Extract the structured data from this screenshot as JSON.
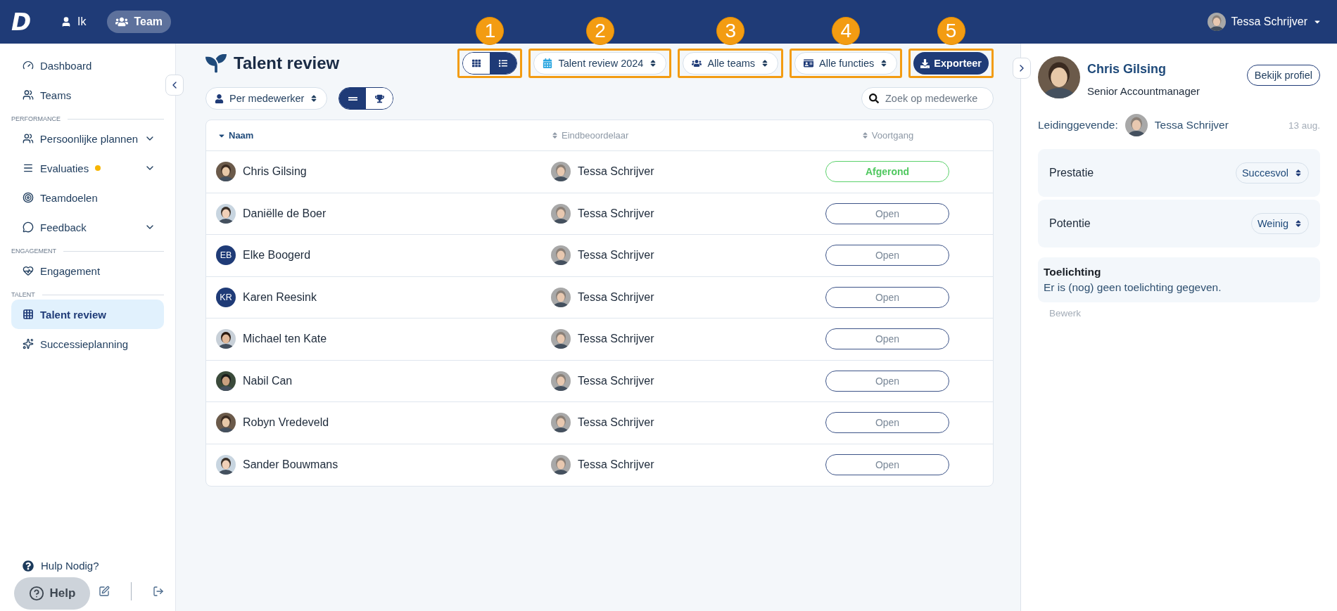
{
  "topbar": {
    "logo": "D",
    "nav": [
      {
        "label": "Ik",
        "selected": false
      },
      {
        "label": "Team",
        "selected": true
      }
    ],
    "user": "Tessa Schrijver"
  },
  "sidebar": {
    "sections": [
      {
        "items": [
          {
            "label": "Dashboard",
            "selected": false,
            "expandable": false,
            "notification": false
          },
          {
            "label": "Teams",
            "selected": false,
            "expandable": false,
            "notification": false
          }
        ]
      },
      {
        "heading": "PERFORMANCE",
        "items": [
          {
            "label": "Persoonlijke plannen",
            "selected": false,
            "expandable": true,
            "notification": false
          },
          {
            "label": "Evaluaties",
            "selected": false,
            "expandable": true,
            "notification": true
          },
          {
            "label": "Teamdoelen",
            "selected": false,
            "expandable": false,
            "notification": false
          },
          {
            "label": "Feedback",
            "selected": false,
            "expandable": true,
            "notification": false
          }
        ]
      },
      {
        "heading": "ENGAGEMENT",
        "items": [
          {
            "label": "Engagement",
            "selected": false,
            "expandable": false,
            "notification": false
          }
        ]
      },
      {
        "heading": "TALENT",
        "items": [
          {
            "label": "Talent review",
            "selected": true,
            "expandable": false,
            "notification": false
          },
          {
            "label": "Successieplanning",
            "selected": false,
            "expandable": false,
            "notification": false
          }
        ]
      }
    ],
    "help_link": "Hulp Nodig?",
    "help_button": "Help"
  },
  "page": {
    "title": "Talent review",
    "toolbar": [
      {
        "kind": "toggle",
        "marker": "1",
        "options": [
          {
            "selected": false
          },
          {
            "selected": true
          }
        ]
      },
      {
        "kind": "select",
        "marker": "2",
        "label": "Talent review 2024"
      },
      {
        "kind": "select",
        "marker": "3",
        "label": "Alle teams"
      },
      {
        "kind": "select",
        "marker": "4",
        "label": "Alle functies"
      },
      {
        "kind": "button",
        "marker": "5",
        "label": "Exporteer"
      }
    ],
    "group_select": "Per medewerker",
    "mode_toggle": [
      {
        "selected": true
      },
      {
        "selected": false
      }
    ],
    "search": {
      "placeholder": "Zoek op medewerke"
    },
    "table": {
      "columns": [
        {
          "label": "Naam",
          "sorted": true
        },
        {
          "label": "Eindbeoordelaar",
          "sorted": false
        },
        {
          "label": "Voortgang",
          "sorted": false
        }
      ],
      "rows": [
        {
          "name": "Chris Gilsing",
          "reviewer": "Tessa Schrijver",
          "status": "Afgerond",
          "done": true
        },
        {
          "name": "Daniëlle de Boer",
          "reviewer": "Tessa Schrijver",
          "status": "Open",
          "done": false
        },
        {
          "name": "Elke Boogerd",
          "initials": "EB",
          "reviewer": "Tessa Schrijver",
          "status": "Open",
          "done": false
        },
        {
          "name": "Karen Reesink",
          "initials": "KR",
          "reviewer": "Tessa Schrijver",
          "status": "Open",
          "done": false
        },
        {
          "name": "Michael ten Kate",
          "reviewer": "Tessa Schrijver",
          "status": "Open",
          "done": false
        },
        {
          "name": "Nabil Can",
          "reviewer": "Tessa Schrijver",
          "status": "Open",
          "done": false
        },
        {
          "name": "Robyn Vredeveld",
          "reviewer": "Tessa Schrijver",
          "status": "Open",
          "done": false
        },
        {
          "name": "Sander Bouwmans",
          "reviewer": "Tessa Schrijver",
          "status": "Open",
          "done": false
        }
      ]
    }
  },
  "panel": {
    "name": "Chris Gilsing",
    "role": "Senior Accountmanager",
    "profile_button": "Bekijk profiel",
    "manager_label": "Leidinggevende:",
    "manager": "Tessa Schrijver",
    "date": "13 aug.",
    "ratings": [
      {
        "label": "Prestatie",
        "value": "Succesvol"
      },
      {
        "label": "Potentie",
        "value": "Weinig"
      }
    ],
    "note": {
      "title": "Toelichting",
      "text": "Er is (nog) geen toelichting gegeven.",
      "edit": "Bewerk"
    }
  }
}
